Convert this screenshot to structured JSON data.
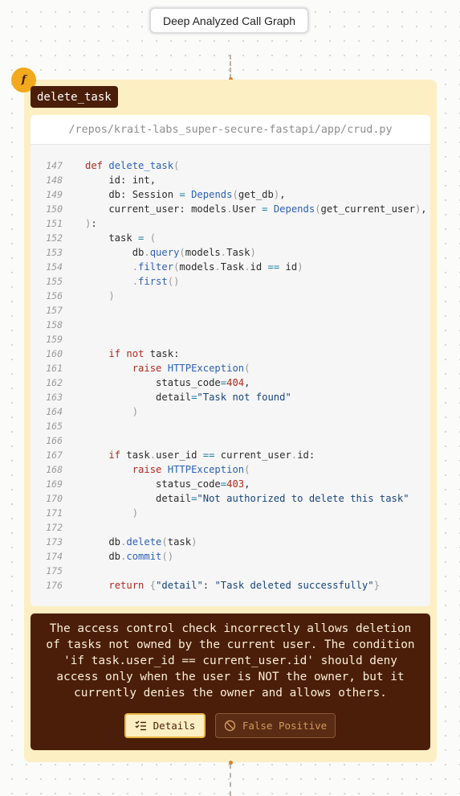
{
  "header": {
    "title": "Deep Analyzed Call Graph"
  },
  "node": {
    "icon": "function-icon",
    "icon_glyph": "f",
    "function_name": "delete_task",
    "file_path": "/repos/krait-labs_super-secure-fastapi/app/crud.py"
  },
  "code": {
    "lines": [
      {
        "n": "147",
        "text": "def delete_task("
      },
      {
        "n": "148",
        "text": "    id: int,"
      },
      {
        "n": "149",
        "text": "    db: Session = Depends(get_db),"
      },
      {
        "n": "150",
        "text": "    current_user: models.User = Depends(get_current_user),"
      },
      {
        "n": "151",
        "text": "):"
      },
      {
        "n": "152",
        "text": "    task = ("
      },
      {
        "n": "153",
        "text": "        db.query(models.Task)"
      },
      {
        "n": "154",
        "text": "        .filter(models.Task.id == id)"
      },
      {
        "n": "155",
        "text": "        .first()"
      },
      {
        "n": "156",
        "text": "    )"
      },
      {
        "n": "157",
        "text": ""
      },
      {
        "n": "158",
        "text": ""
      },
      {
        "n": "159",
        "text": ""
      },
      {
        "n": "160",
        "text": "    if not task:"
      },
      {
        "n": "161",
        "text": "        raise HTTPException("
      },
      {
        "n": "162",
        "text": "            status_code=404,"
      },
      {
        "n": "163",
        "text": "            detail=\"Task not found\""
      },
      {
        "n": "164",
        "text": "        )"
      },
      {
        "n": "165",
        "text": ""
      },
      {
        "n": "166",
        "text": ""
      },
      {
        "n": "167",
        "text": "    if task.user_id == current_user.id:"
      },
      {
        "n": "168",
        "text": "        raise HTTPException("
      },
      {
        "n": "169",
        "text": "            status_code=403,"
      },
      {
        "n": "170",
        "text": "            detail=\"Not authorized to delete this task\""
      },
      {
        "n": "171",
        "text": "        )"
      },
      {
        "n": "172",
        "text": ""
      },
      {
        "n": "173",
        "text": "    db.delete(task)"
      },
      {
        "n": "174",
        "text": "    db.commit()"
      },
      {
        "n": "175",
        "text": ""
      },
      {
        "n": "176",
        "text": "    return {\"detail\": \"Task deleted successfully\"}"
      }
    ]
  },
  "finding": {
    "description": "The access control check incorrectly allows deletion of tasks not owned by the current user. The condition 'if task.user_id == current_user.id' should deny access only when the user is NOT the owner, but it currently denies the owner and allows others.",
    "details_label": "Details",
    "details_icon": "list-icon",
    "false_positive_label": "False Positive",
    "false_positive_icon": "ban-icon"
  },
  "colors": {
    "card_background": "#fdefc4",
    "accent_dark": "#4a1e08",
    "icon_orange": "#f2a91d",
    "keyword_red": "#b5281e",
    "function_blue": "#2d62b5"
  }
}
